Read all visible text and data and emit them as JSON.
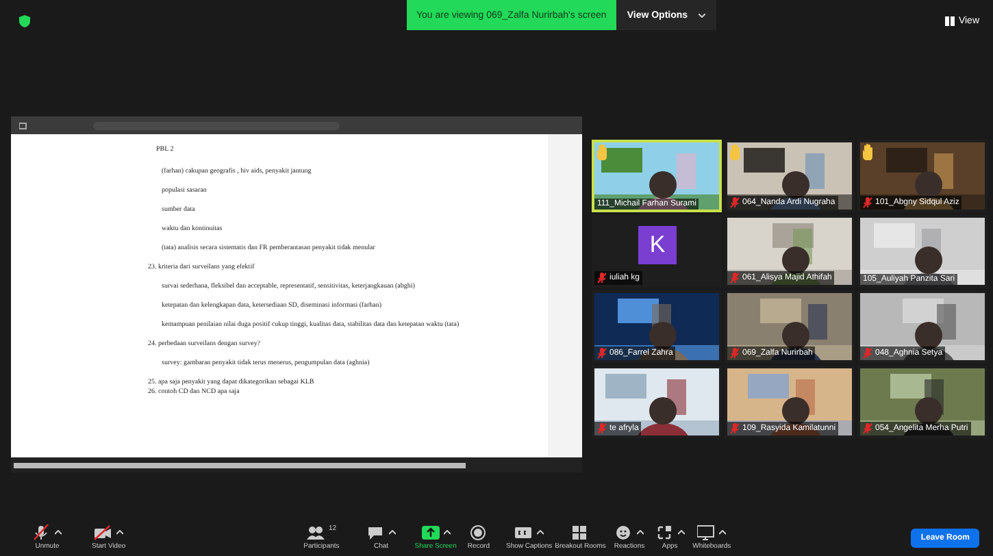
{
  "top_bar": {
    "banner": "You are viewing 069_Zalfa Nurirbah's screen",
    "view_options": "View Options",
    "view": "View"
  },
  "shared_document": {
    "heading": "PBL 2",
    "lines": [
      {
        "kind": "indent",
        "text": "(farhan) cakupan geografis , hiv aids, penyakit jantung"
      },
      {
        "kind": "indent",
        "text": "populasi sasaran"
      },
      {
        "kind": "indent",
        "text": "sumber data"
      },
      {
        "kind": "indent",
        "text": "waktu dan kontinuitas"
      },
      {
        "kind": "indent",
        "text": "(tata) analisis secara sistematis dan FR pemberantasan penyakit tidak menular"
      },
      {
        "kind": "numbered",
        "text": "23. kriteria dari surveilans yang efektif"
      },
      {
        "kind": "indent",
        "text": "survai sederhana, fleksibel dan acceptable, representatif, sensitivitas, keterjangkauan (abghi)"
      },
      {
        "kind": "indent",
        "text": "ketepatan dan kelengkapan data, ketersediaan SD, diseminasi informasi (farhan)"
      },
      {
        "kind": "indent",
        "text": "kemampuan penilaian nilai duga positif cukup tinggi, kualitas data, stabilitas data dan ketepatan waktu (tata)"
      },
      {
        "kind": "numbered",
        "text": "24. perbedaan surveilans dengan survey?"
      },
      {
        "kind": "indent",
        "text": "survey: gambaran penyakit tidak terus menerus, pengumpulan data (aghnia)"
      },
      {
        "kind": "numbered",
        "text": "25. apa saja penyakit yang dapat dikategorikan sebagai KLB"
      },
      {
        "kind": "numbered",
        "text": "26. contoh CD dan NCD apa saja"
      }
    ]
  },
  "participants": [
    {
      "kind": "video",
      "name": "111_Michail Farhan Surami",
      "muted": false,
      "hand_raised": true,
      "active_speaker": true
    },
    {
      "kind": "video",
      "name": "064_Nanda Ardi Nugraha",
      "muted": true,
      "hand_raised": true,
      "active_speaker": false
    },
    {
      "kind": "video",
      "name": "101_Abgny Sidqul Aziz",
      "muted": true,
      "hand_raised": true,
      "active_speaker": false
    },
    {
      "kind": "avatar",
      "avatar": "K",
      "name": "iuliah kg",
      "muted": true,
      "hand_raised": false,
      "active_speaker": false
    },
    {
      "kind": "video",
      "name": "061_Alisya Majid Athifah",
      "muted": true,
      "hand_raised": false,
      "active_speaker": false
    },
    {
      "kind": "video",
      "name": "105_Auliyah Panzita Sari",
      "muted": false,
      "hand_raised": false,
      "active_speaker": false
    },
    {
      "kind": "video",
      "name": "086_Farrel Zahra",
      "muted": true,
      "hand_raised": false,
      "active_speaker": false
    },
    {
      "kind": "video",
      "name": "069_Zalfa Nurirbah",
      "muted": true,
      "hand_raised": false,
      "active_speaker": false
    },
    {
      "kind": "video",
      "name": "048_Aghnia Setya",
      "muted": true,
      "hand_raised": false,
      "active_speaker": false
    },
    {
      "kind": "video",
      "name": "te afryla",
      "muted": true,
      "hand_raised": false,
      "active_speaker": false
    },
    {
      "kind": "video",
      "name": "109_Rasyida Kamilatunni",
      "muted": true,
      "hand_raised": false,
      "active_speaker": false
    },
    {
      "kind": "video",
      "name": "054_Angelita Merha Putri",
      "muted": true,
      "hand_raised": false,
      "active_speaker": false
    }
  ],
  "toolbar": [
    {
      "kind": "mic",
      "label": "Unmute",
      "caret": true
    },
    {
      "kind": "video",
      "label": "Start Video",
      "caret": true
    },
    {
      "kind": "participants",
      "label": "Participants",
      "count": "12",
      "caret": false
    },
    {
      "kind": "chat",
      "label": "Chat",
      "caret": true
    },
    {
      "kind": "share",
      "label": "Share Screen",
      "caret": true
    },
    {
      "kind": "record",
      "label": "Record",
      "caret": false
    },
    {
      "kind": "captions",
      "label": "Show Captions",
      "caret": true
    },
    {
      "kind": "breakout",
      "label": "Breakout Rooms",
      "caret": false
    },
    {
      "kind": "reactions",
      "label": "Reactions",
      "caret": true
    },
    {
      "kind": "apps",
      "label": "Apps",
      "caret": true
    },
    {
      "kind": "whiteboards",
      "label": "Whiteboards",
      "caret": true
    }
  ],
  "leave_button": "Leave Room"
}
